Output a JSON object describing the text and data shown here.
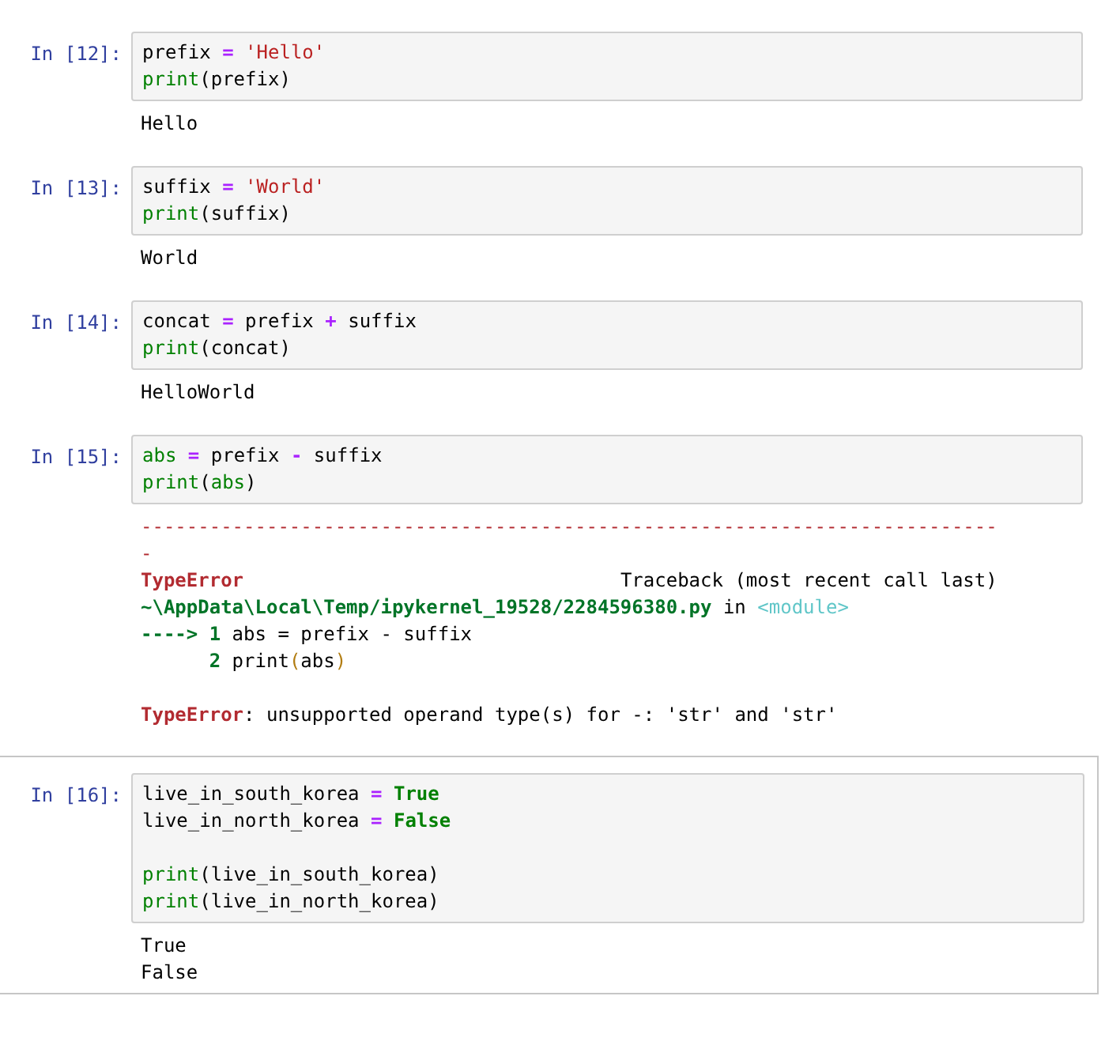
{
  "cells": [
    {
      "prompt": "In [12]:",
      "selected": false,
      "code": [
        {
          "lines": [
            {
              "tokens": [
                {
                  "text": "prefix",
                  "kind": "plain"
                },
                {
                  "text": " = ",
                  "kind": "operator"
                },
                {
                  "text": "'Hello'",
                  "kind": "string"
                }
              ]
            },
            {
              "tokens": [
                {
                  "text": "print",
                  "kind": "builtin"
                },
                {
                  "text": "(prefix)",
                  "kind": "plain"
                }
              ]
            }
          ]
        }
      ],
      "output": [
        {
          "lines": [
            {
              "tokens": [
                {
                  "text": "Hello",
                  "kind": "plain"
                }
              ]
            }
          ]
        }
      ]
    },
    {
      "prompt": "In [13]:",
      "selected": false,
      "code": [
        {
          "lines": [
            {
              "tokens": [
                {
                  "text": "suffix",
                  "kind": "plain"
                },
                {
                  "text": " = ",
                  "kind": "operator"
                },
                {
                  "text": "'World'",
                  "kind": "string"
                }
              ]
            },
            {
              "tokens": [
                {
                  "text": "print",
                  "kind": "builtin"
                },
                {
                  "text": "(suffix)",
                  "kind": "plain"
                }
              ]
            }
          ]
        }
      ],
      "output": [
        {
          "lines": [
            {
              "tokens": [
                {
                  "text": "World",
                  "kind": "plain"
                }
              ]
            }
          ]
        }
      ]
    },
    {
      "prompt": "In [14]:",
      "selected": false,
      "code": [
        {
          "lines": [
            {
              "tokens": [
                {
                  "text": "concat",
                  "kind": "plain"
                },
                {
                  "text": " = ",
                  "kind": "operator"
                },
                {
                  "text": "prefix",
                  "kind": "plain"
                },
                {
                  "text": " + ",
                  "kind": "operator"
                },
                {
                  "text": "suffix",
                  "kind": "plain"
                }
              ]
            },
            {
              "tokens": [
                {
                  "text": "print",
                  "kind": "builtin"
                },
                {
                  "text": "(concat)",
                  "kind": "plain"
                }
              ]
            }
          ]
        }
      ],
      "output": [
        {
          "lines": [
            {
              "tokens": [
                {
                  "text": "HelloWorld",
                  "kind": "plain"
                }
              ]
            }
          ]
        }
      ]
    },
    {
      "prompt": "In [15]:",
      "selected": false,
      "code": [
        {
          "lines": [
            {
              "tokens": [
                {
                  "text": "abs",
                  "kind": "builtin"
                },
                {
                  "text": " = ",
                  "kind": "operator"
                },
                {
                  "text": "prefix",
                  "kind": "plain"
                },
                {
                  "text": " - ",
                  "kind": "operator"
                },
                {
                  "text": "suffix",
                  "kind": "plain"
                }
              ]
            },
            {
              "tokens": [
                {
                  "text": "print",
                  "kind": "builtin"
                },
                {
                  "text": "(",
                  "kind": "plain"
                },
                {
                  "text": "abs",
                  "kind": "builtin"
                },
                {
                  "text": ")",
                  "kind": "plain"
                }
              ]
            }
          ]
        }
      ],
      "output": [
        {
          "lines": [
            {
              "tokens": [
                {
                  "text": "---------------------------------------------------------------------------",
                  "kind": "error"
                }
              ]
            },
            {
              "tokens": [
                {
                  "text": "-",
                  "kind": "error"
                }
              ]
            },
            {
              "tokens": [
                {
                  "text": "TypeError",
                  "kind": "error-bold"
                },
                {
                  "text": "                                 Traceback (most recent call last)",
                  "kind": "plain"
                }
              ]
            },
            {
              "tokens": [
                {
                  "text": "~\\AppData\\Local\\Temp/ipykernel_19528/2284596380.py",
                  "kind": "path"
                },
                {
                  "text": " in ",
                  "kind": "plain"
                },
                {
                  "text": "<module>",
                  "kind": "module"
                }
              ]
            },
            {
              "tokens": [
                {
                  "text": "----> 1",
                  "kind": "path"
                },
                {
                  "text": " abs = prefix - suffix",
                  "kind": "plain"
                }
              ]
            },
            {
              "tokens": [
                {
                  "text": "      2",
                  "kind": "path"
                },
                {
                  "text": " print",
                  "kind": "plain"
                },
                {
                  "text": "(",
                  "kind": "paren"
                },
                {
                  "text": "abs",
                  "kind": "plain"
                },
                {
                  "text": ")",
                  "kind": "paren"
                }
              ]
            }
          ]
        },
        {
          "lines": [
            {
              "tokens": [
                {
                  "text": "TypeError",
                  "kind": "error-bold"
                },
                {
                  "text": ": unsupported operand type(s) for -: 'str' and 'str'",
                  "kind": "plain"
                }
              ]
            }
          ]
        }
      ]
    },
    {
      "prompt": "In [16]:",
      "selected": true,
      "code": [
        {
          "lines": [
            {
              "tokens": [
                {
                  "text": "live_in_south_korea",
                  "kind": "plain"
                },
                {
                  "text": " = ",
                  "kind": "operator"
                },
                {
                  "text": "True",
                  "kind": "keyword"
                }
              ]
            },
            {
              "tokens": [
                {
                  "text": "live_in_north_korea",
                  "kind": "plain"
                },
                {
                  "text": " = ",
                  "kind": "operator"
                },
                {
                  "text": "False",
                  "kind": "keyword"
                }
              ]
            }
          ]
        },
        {
          "lines": [
            {
              "tokens": [
                {
                  "text": "print",
                  "kind": "builtin"
                },
                {
                  "text": "(live_in_south_korea)",
                  "kind": "plain"
                }
              ]
            },
            {
              "tokens": [
                {
                  "text": "print",
                  "kind": "builtin"
                },
                {
                  "text": "(live_in_north_korea)",
                  "kind": "plain"
                }
              ]
            }
          ]
        }
      ],
      "output": [
        {
          "lines": [
            {
              "tokens": [
                {
                  "text": "True",
                  "kind": "plain"
                }
              ]
            },
            {
              "tokens": [
                {
                  "text": "False",
                  "kind": "plain"
                }
              ]
            }
          ]
        }
      ]
    }
  ]
}
